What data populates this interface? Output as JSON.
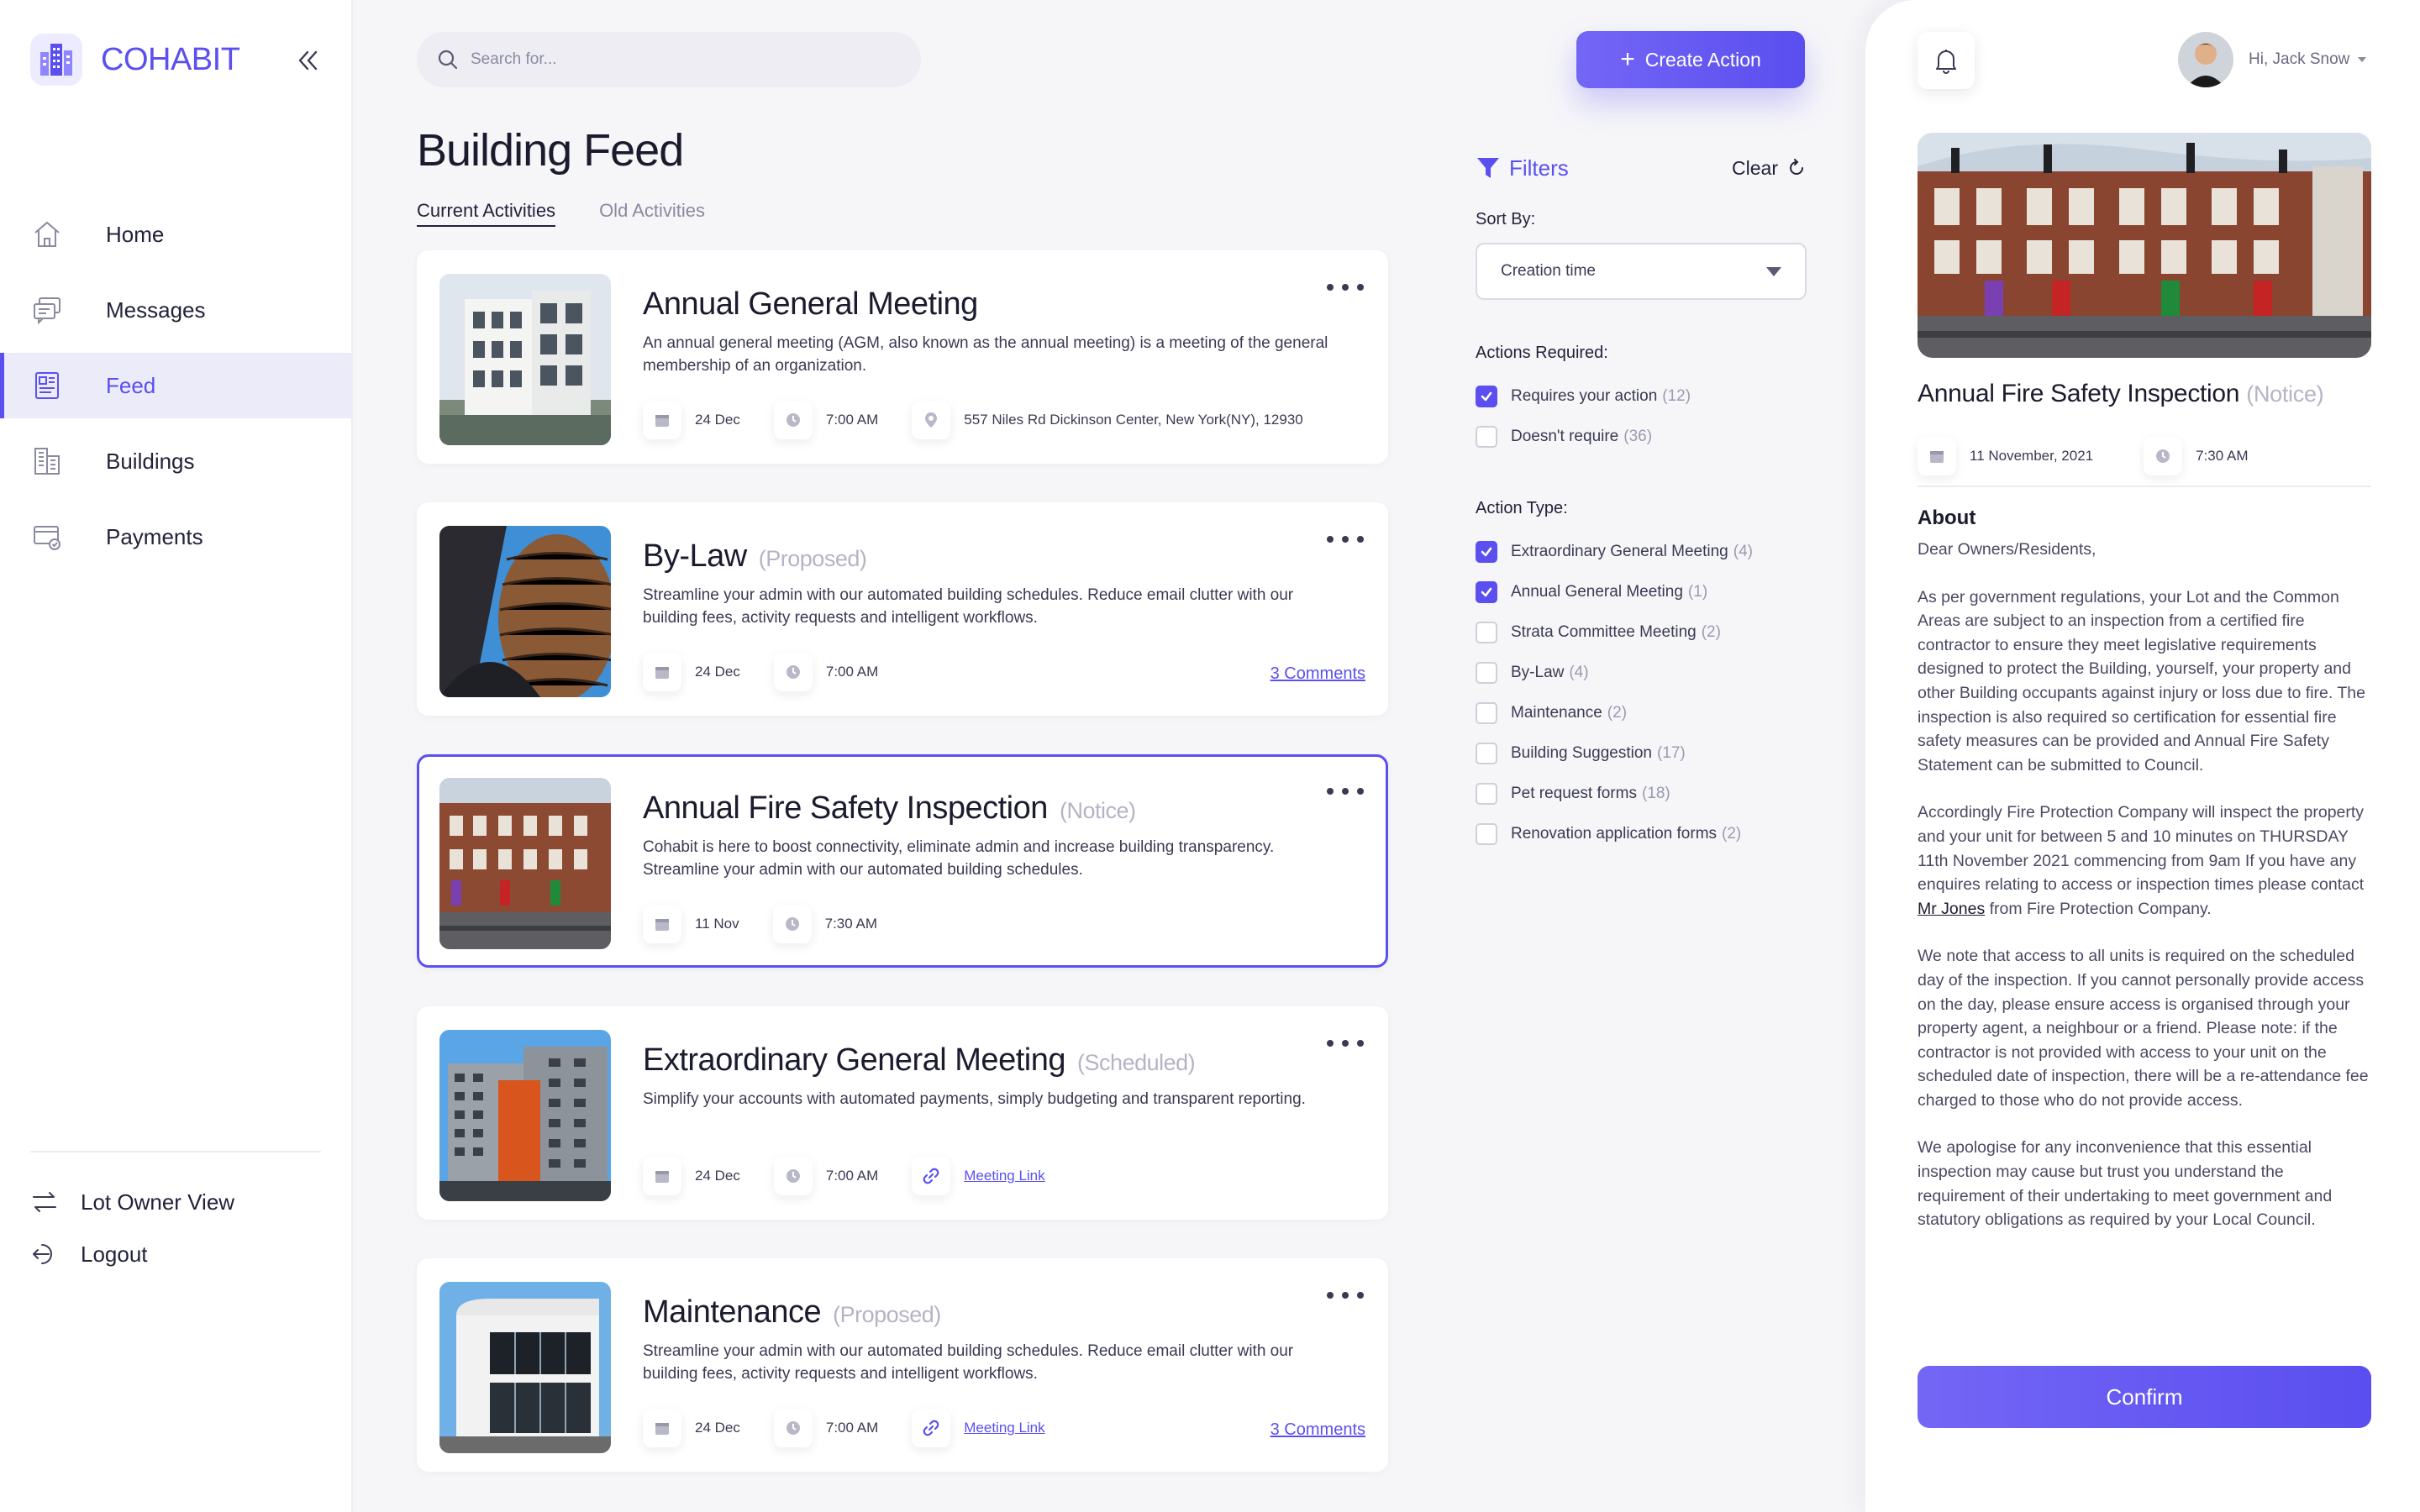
{
  "brand": {
    "name": "COHABIT",
    "accent": "#5B4FF0"
  },
  "sidebar": {
    "items": [
      {
        "label": "Home",
        "icon": "home-icon"
      },
      {
        "label": "Messages",
        "icon": "messages-icon"
      },
      {
        "label": "Feed",
        "icon": "feed-icon",
        "active": true
      },
      {
        "label": "Buildings",
        "icon": "buildings-icon"
      },
      {
        "label": "Payments",
        "icon": "payments-icon"
      }
    ],
    "bottom": [
      {
        "label": "Lot Owner View",
        "icon": "swap-icon"
      },
      {
        "label": "Logout",
        "icon": "logout-icon"
      }
    ]
  },
  "header": {
    "search_placeholder": "Search for...",
    "create_label": "Create Action"
  },
  "page": {
    "title": "Building Feed",
    "tabs": [
      {
        "label": "Current Activities",
        "active": true
      },
      {
        "label": "Old Activities",
        "active": false
      }
    ]
  },
  "feed": [
    {
      "title": "Annual General Meeting",
      "status": "",
      "description": "An annual general meeting (AGM, also known as the annual meeting) is a meeting of the general membership of an organization.",
      "date": "24 Dec",
      "time": "7:00 AM",
      "location": "557 Niles Rd Dickinson Center, New York(NY), 12930"
    },
    {
      "title": "By-Law",
      "status": "(Proposed)",
      "description": "Streamline your admin with our automated building schedules. Reduce email clutter with our building fees, activity requests and intelligent workflows.",
      "date": "24 Dec",
      "time": "7:00 AM",
      "comments": "3 Comments"
    },
    {
      "title": "Annual Fire Safety Inspection",
      "status": "(Notice)",
      "description": "Cohabit is here to boost connectivity, eliminate admin and increase building transparency. Streamline your admin with our automated building schedules.",
      "date": "11 Nov",
      "time": "7:30 AM",
      "selected": true
    },
    {
      "title": "Extraordinary General Meeting",
      "status": "(Scheduled)",
      "description": "Simplify your accounts with automated payments, simply budgeting and transparent reporting.",
      "date": "24 Dec",
      "time": "7:00 AM",
      "link": "Meeting Link"
    },
    {
      "title": "Maintenance",
      "status": "(Proposed)",
      "description": "Streamline your admin with our automated building schedules. Reduce email clutter with our building fees, activity requests and intelligent workflows.",
      "date": "24 Dec",
      "time": "7:00 AM",
      "link": "Meeting Link",
      "comments": "3 Comments"
    }
  ],
  "filters": {
    "title": "Filters",
    "clear_label": "Clear",
    "sort_label": "Sort By:",
    "sort_value": "Creation time",
    "actions_label": "Actions Required:",
    "actions": [
      {
        "label": "Requires your action",
        "count": "(12)",
        "checked": true
      },
      {
        "label": "Doesn't require",
        "count": "(36)",
        "checked": false
      }
    ],
    "types_label": "Action Type:",
    "types": [
      {
        "label": "Extraordinary General Meeting",
        "count": "(4)",
        "checked": true
      },
      {
        "label": "Annual General Meeting",
        "count": "(1)",
        "checked": true
      },
      {
        "label": "Strata Committee Meeting",
        "count": "(2)",
        "checked": false
      },
      {
        "label": "By-Law",
        "count": "(4)",
        "checked": false
      },
      {
        "label": "Maintenance",
        "count": "(2)",
        "checked": false
      },
      {
        "label": "Building Suggestion",
        "count": "(17)",
        "checked": false
      },
      {
        "label": "Pet request forms",
        "count": "(18)",
        "checked": false
      },
      {
        "label": "Renovation application forms",
        "count": "(2)",
        "checked": false
      }
    ]
  },
  "panel": {
    "greeting": "Hi, Jack Snow",
    "title": "Annual Fire Safety Inspection",
    "status": "(Notice)",
    "date": "11 November, 2021",
    "time": "7:30 AM",
    "about_heading": "About",
    "salutation": "Dear Owners/Residents,",
    "para1": "As per government regulations, your Lot and the Common Areas are subject to an inspection from a certified fire contractor to ensure they meet legislative requirements designed to protect the Building, yourself, your property and other Building occupants against injury or loss due to fire. The inspection is also required so certification for essential fire safety measures can be provided and Annual Fire Safety Statement can be submitted to Council.",
    "para2_before": "Accordingly Fire Protection Company will inspect the property and your unit for between 5 and 10 minutes on THURSDAY 11th November 2021 commencing from 9am If you have any enquires relating to access or inspection times please contact ",
    "para2_link": "Mr Jones",
    "para2_after": " from Fire Protection Company.",
    "para3": "We note that access to all units is required on the scheduled day of the inspection. If you cannot personally provide access on the day, please ensure access is organised through your property agent, a neighbour or a friend. Please note: if the contractor is not provided with access to your unit on the scheduled date of inspection, there will be a re-attendance fee charged to those who do not provide access.",
    "para4": "We apologise for any inconvenience that this essential inspection may cause but trust you understand the requirement of their undertaking to meet government and statutory obligations as required by your Local Council.",
    "confirm_label": "Confirm"
  }
}
